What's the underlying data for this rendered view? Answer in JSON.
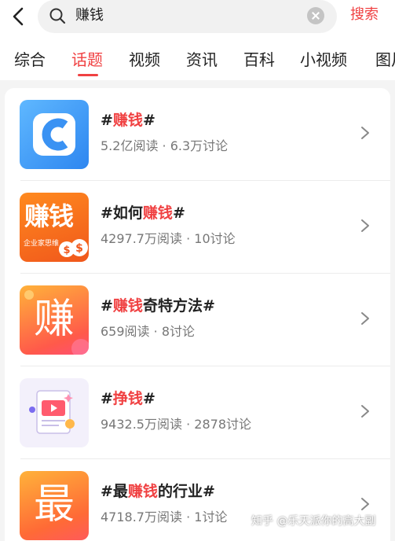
{
  "search": {
    "query": "赚钱",
    "submit_label": "搜索"
  },
  "tabs": [
    "综合",
    "话题",
    "视频",
    "资讯",
    "百科",
    "小视频",
    "图片"
  ],
  "active_tab": 1,
  "results": [
    {
      "title_prefix": "#",
      "title_hl": "赚钱",
      "title_suffix": "#",
      "reads": "5.2亿阅读",
      "discussions": "6.3万讨论",
      "thumb_icon": "c-logo-icon"
    },
    {
      "title_prefix": "#如何",
      "title_hl": "赚钱",
      "title_suffix": "#",
      "reads": "4297.7万阅读",
      "discussions": "10讨论",
      "thumb_icon": "money-bag-icon",
      "thumb_text": "赚钱",
      "thumb_subtext": "企业家思维"
    },
    {
      "title_prefix": "#",
      "title_hl": "赚钱",
      "title_suffix": "奇特方法#",
      "reads": "659阅读",
      "discussions": "8讨论",
      "thumb_icon": "zhuan-character-icon",
      "thumb_text": "赚"
    },
    {
      "title_prefix": "#",
      "title_hl": "挣钱",
      "title_suffix": "#",
      "reads": "9432.5万阅读",
      "discussions": "2878讨论",
      "thumb_icon": "video-document-icon"
    },
    {
      "title_prefix": "#最",
      "title_hl": "赚钱",
      "title_suffix": "的行业#",
      "reads": "4718.7万阅读",
      "discussions": "1讨论",
      "thumb_icon": "zui-character-icon",
      "thumb_text": "最"
    }
  ],
  "meta_separator": "·",
  "watermark": "知乎 @乐天派你的高大副",
  "colors": {
    "accent": "#f04142",
    "background": "#f4f4f4",
    "card": "#ffffff",
    "meta_text": "#777777"
  }
}
